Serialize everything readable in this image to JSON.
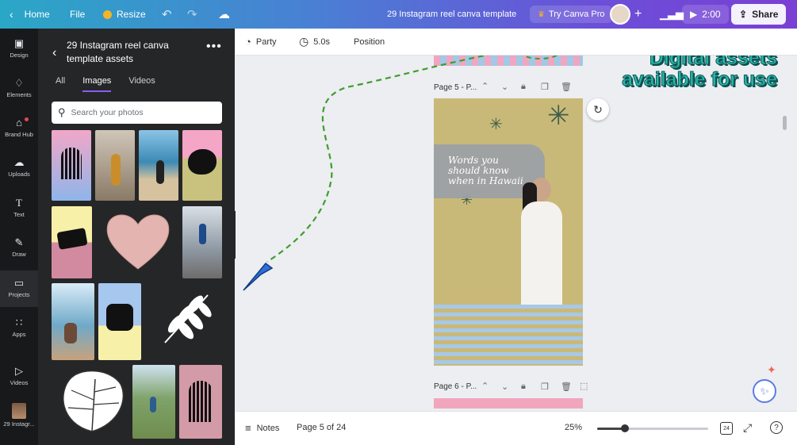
{
  "topbar": {
    "home": "Home",
    "file": "File",
    "resize": "Resize",
    "title": "29 Instagram reel canva template",
    "try_pro": "Try Canva Pro",
    "play_time": "2:00",
    "share": "Share"
  },
  "rail": {
    "design": "Design",
    "elements": "Elements",
    "brand_hub": "Brand Hub",
    "uploads": "Uploads",
    "text": "Text",
    "draw": "Draw",
    "projects": "Projects",
    "apps": "Apps",
    "videos": "Videos",
    "recent": "29 Instagr..."
  },
  "panel": {
    "title": "29 Instagram reel canva template assets",
    "tabs": [
      "All",
      "Images",
      "Videos"
    ],
    "search_placeholder": "Search your photos"
  },
  "props": {
    "animation": "Party",
    "duration": "5.0s",
    "position": "Position"
  },
  "pages": {
    "page5_label": "Page 5 - P...",
    "page6_label": "Page 6 - P..."
  },
  "design_text": "Words you should know when in Hawaii",
  "overlay": {
    "line1": "Digital assets",
    "line2": "available for use"
  },
  "bottombar": {
    "notes": "Notes",
    "page_indicator": "Page 5 of 24",
    "zoom": "25%",
    "zoom_level": 0.25,
    "grid_count": "24"
  },
  "colors": {
    "accent": "#8b5cf6",
    "overlay_text": "#2bb5a7",
    "design_bg": "#c9b978",
    "arrow": "#3f9d2f"
  }
}
